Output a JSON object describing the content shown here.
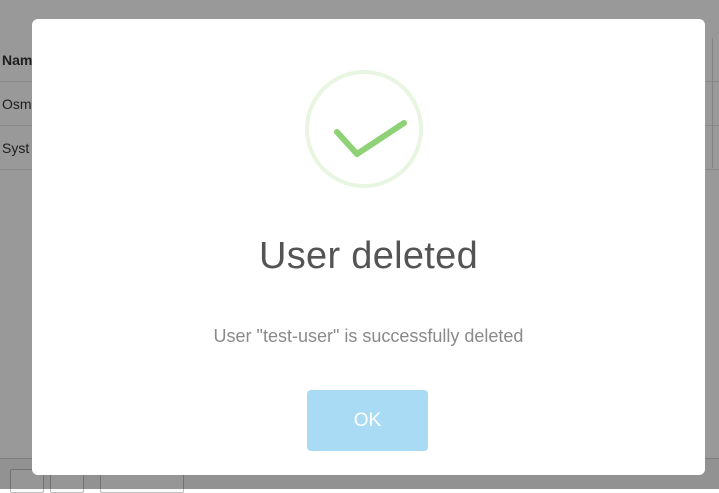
{
  "background": {
    "table": {
      "header_cell": "Nam",
      "rows": [
        "Osm",
        "Syst"
      ]
    }
  },
  "modal": {
    "icon": "checkmark-icon",
    "title": "User deleted",
    "message": "User \"test-user\" is successfully deleted",
    "ok_label": "OK"
  },
  "colors": {
    "success_green": "#8fd177",
    "ok_button": "#a9dbf4",
    "overlay": "rgba(0,0,0,0.4)"
  }
}
